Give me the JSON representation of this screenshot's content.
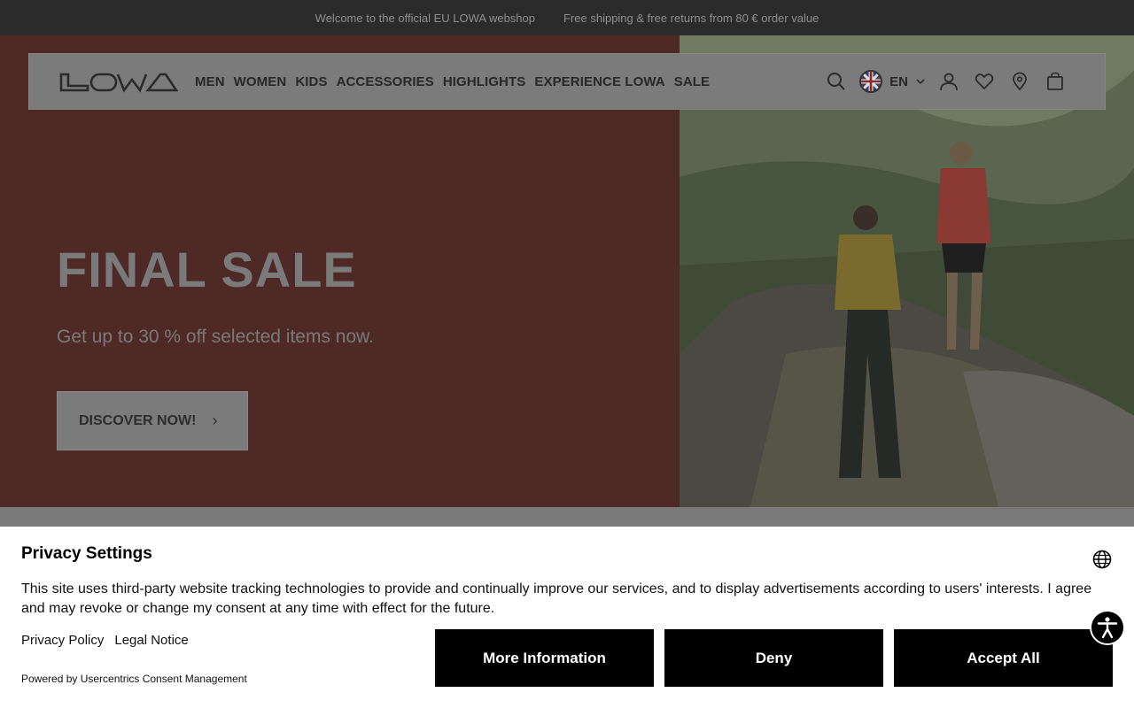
{
  "topbar": {
    "welcome": "Welcome to the official EU LOWA webshop",
    "shipping": "Free shipping & free returns from 80 € order value"
  },
  "nav": {
    "logo_text": "LOWA",
    "menu": [
      "MEN",
      "WOMEN",
      "KIDS",
      "ACCESSORIES",
      "HIGHLIGHTS",
      "EXPERIENCE LOWA",
      "SALE"
    ],
    "language": "EN",
    "icons": [
      "search-icon",
      "flag-icon",
      "chevron-down-icon",
      "account-icon",
      "wishlist-icon",
      "store-locator-icon",
      "cart-icon"
    ]
  },
  "hero": {
    "title": "FINAL SALE",
    "subtitle": "Get up to 30 % off selected items now.",
    "cta": "DISCOVER NOW!"
  },
  "privacy": {
    "title": "Privacy Settings",
    "text": "This site uses third-party website tracking technologies to provide and continually improve our services, and to display advertisements according to users' interests. I agree and may revoke or change my consent at any time with effect for the future.",
    "links": [
      "Privacy Policy",
      "Legal Notice"
    ],
    "powered_by": "Powered by Usercentrics Consent Management",
    "buttons": [
      "More Information",
      "Deny",
      "Accept All"
    ]
  },
  "colors": {
    "topbar_bg": "#2b2b2b",
    "hero_left_bg": "#4f2925",
    "overlay_gray": "#7b7b7b",
    "button_black": "#000000"
  }
}
